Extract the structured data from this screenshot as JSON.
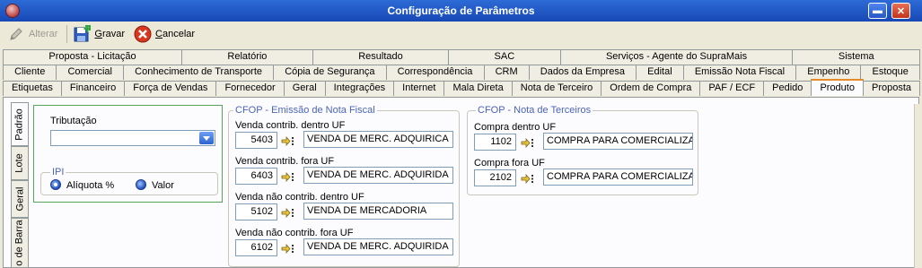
{
  "window": {
    "title": "Configuração de Parâmetros",
    "minimize": "▬",
    "close": "✕"
  },
  "toolbar": {
    "alterar": "Alterar",
    "gravar": "Gravar",
    "cancelar": "Cancelar"
  },
  "tabs": {
    "row1": [
      "Proposta - Licitação",
      "Relatório",
      "Resultado",
      "SAC",
      "Serviços - Agente do SupraMais",
      "Sistema"
    ],
    "row2": [
      "Cliente",
      "Comercial",
      "Conhecimento de Transporte",
      "Cópia de Segurança",
      "Correspondência",
      "CRM",
      "Dados da Empresa",
      "Edital",
      "Emissão Nota Fiscal",
      "Empenho",
      "Estoque"
    ],
    "row3": [
      "Etiquetas",
      "Financeiro",
      "Força de Vendas",
      "Fornecedor",
      "Geral",
      "Integrações",
      "Internet",
      "Mala Direta",
      "Nota de Terceiro",
      "Ordem de Compra",
      "PAF / ECF",
      "Pedido",
      "Produto",
      "Proposta"
    ],
    "active": "Produto"
  },
  "side_tabs": [
    "Padrão",
    "Lote",
    "Geral",
    "o de Barra"
  ],
  "tributacao": {
    "label": "Tributação",
    "value": ""
  },
  "ipi": {
    "legend": "IPI",
    "opt_aliquota": "Alíquota %",
    "opt_valor": "Valor",
    "selected": "Alíquota %"
  },
  "cfop_nf": {
    "legend": "CFOP - Emissão de Nota Fiscal",
    "rows": [
      {
        "label": "Venda contrib. dentro UF",
        "code": "5403",
        "desc": "VENDA DE MERC. ADQUIRICA"
      },
      {
        "label": "Venda contrib. fora UF",
        "code": "6403",
        "desc": "VENDA DE MERC. ADQUIRIDA"
      },
      {
        "label": "Venda não contrib. dentro UF",
        "code": "5102",
        "desc": "VENDA DE MERCADORIA"
      },
      {
        "label": "Venda não contrib. fora UF",
        "code": "6102",
        "desc": "VENDA DE MERC. ADQUIRIDA"
      }
    ]
  },
  "cfop_terceiros": {
    "legend": "CFOP - Nota de Terceiros",
    "rows": [
      {
        "label": "Compra dentro UF",
        "code": "1102",
        "desc": "COMPRA PARA COMERCIALIZA"
      },
      {
        "label": "Compra fora UF",
        "code": "2102",
        "desc": "COMPRA PARA COMERCIALIZA"
      }
    ]
  }
}
